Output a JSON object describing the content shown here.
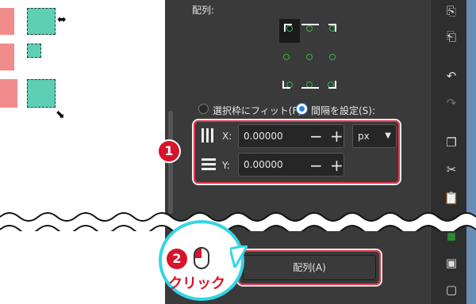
{
  "section": {
    "title": "配列:"
  },
  "radios": {
    "fit_label": "選択枠にフィット(F)",
    "spacing_label": "間隔を設定(S):",
    "selected": "spacing"
  },
  "spacing": {
    "x_label": "X:",
    "x_value": "0.00000",
    "y_label": "Y:",
    "y_value": "0.00000",
    "minus": "−",
    "plus": "+",
    "unit": "px"
  },
  "annotations": {
    "step1": "1",
    "step2": "2",
    "click": "クリック"
  },
  "arrange_button": {
    "label": "配列(A)"
  },
  "colors": {
    "accent_red": "#d7142a",
    "highlight_cyan": "#34d5e6",
    "teal": "#5ecfb4",
    "pink": "#f08c8c"
  },
  "icons": [
    "import-icon",
    "export-icon",
    "undo-icon",
    "redo-icon",
    "duplicate-icon",
    "cut-icon",
    "paste-icon",
    "layer-icon",
    "group-icon",
    "ungroup-icon"
  ]
}
